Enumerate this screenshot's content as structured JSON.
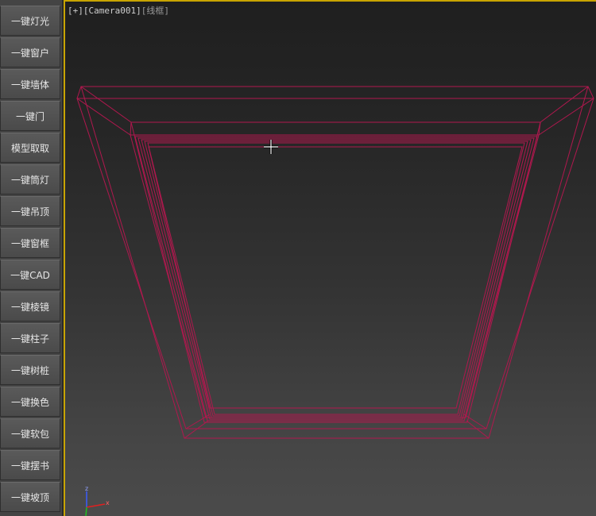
{
  "toolbar": {
    "buttons": [
      "一键灯光",
      "一键窗户",
      "一键墙体",
      "一键门",
      "模型取取",
      "一键筒灯",
      "一键吊顶",
      "一键窗框",
      "一键CAD",
      "一键棱镜",
      "一键柱子",
      "一键树桩",
      "一键换色",
      "一键软包",
      "一键摆书",
      "一键坡顶"
    ]
  },
  "viewport": {
    "plus": "[+]",
    "camera": "[Camera001]",
    "mode": "[线框]",
    "axis_z": "z",
    "axis_x": "x"
  },
  "colors": {
    "wireframe": "#b0184e",
    "active_border": "#c8a400"
  }
}
